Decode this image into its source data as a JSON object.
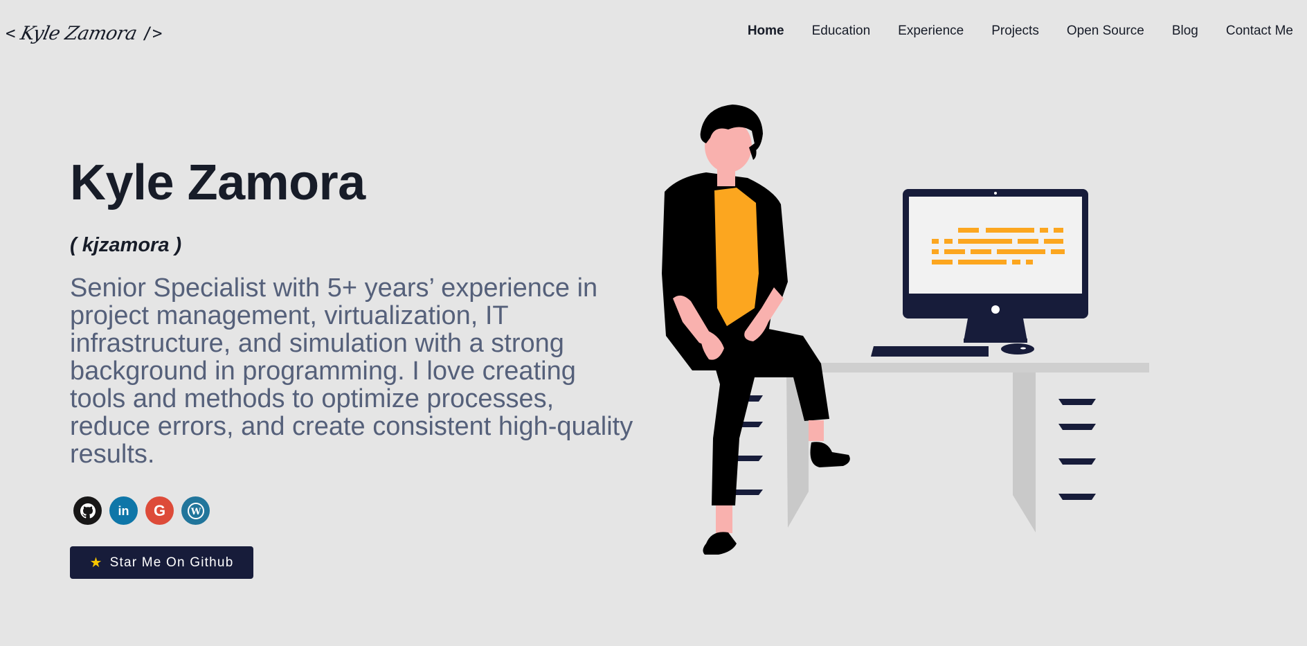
{
  "header": {
    "logo_open": "<",
    "logo_name": "Kyle Zamora",
    "logo_close": "/>",
    "nav": [
      {
        "label": "Home",
        "active": true
      },
      {
        "label": "Education",
        "active": false
      },
      {
        "label": "Experience",
        "active": false
      },
      {
        "label": "Projects",
        "active": false
      },
      {
        "label": "Open Source",
        "active": false
      },
      {
        "label": "Blog",
        "active": false
      },
      {
        "label": "Contact Me",
        "active": false
      }
    ]
  },
  "hero": {
    "name": "Kyle Zamora",
    "nickname": "( kjzamora )",
    "bio": "Senior Specialist with 5+ years’ experience in project management, virtualization, IT infrastructure, and simulation with a strong background in programming. I love creating tools and methods to optimize processes, reduce errors, and create consistent high-quality results.",
    "socials": [
      {
        "icon": "github-icon",
        "color": "#181717"
      },
      {
        "icon": "linkedin-icon",
        "color": "#0e76a8",
        "glyph": "in"
      },
      {
        "icon": "google-icon",
        "color": "#dd4b39",
        "glyph": "G"
      },
      {
        "icon": "wordpress-icon",
        "color": "#21759b",
        "glyph": "W"
      }
    ],
    "star_button": {
      "icon": "star-icon",
      "glyph": "★",
      "label": "Star Me On Github"
    }
  },
  "colors": {
    "background": "#e5e5e5",
    "primary_text": "#171c28",
    "secondary_text": "#55607a",
    "accent_yellow": "#fca61f",
    "button_bg": "#171c3a"
  }
}
